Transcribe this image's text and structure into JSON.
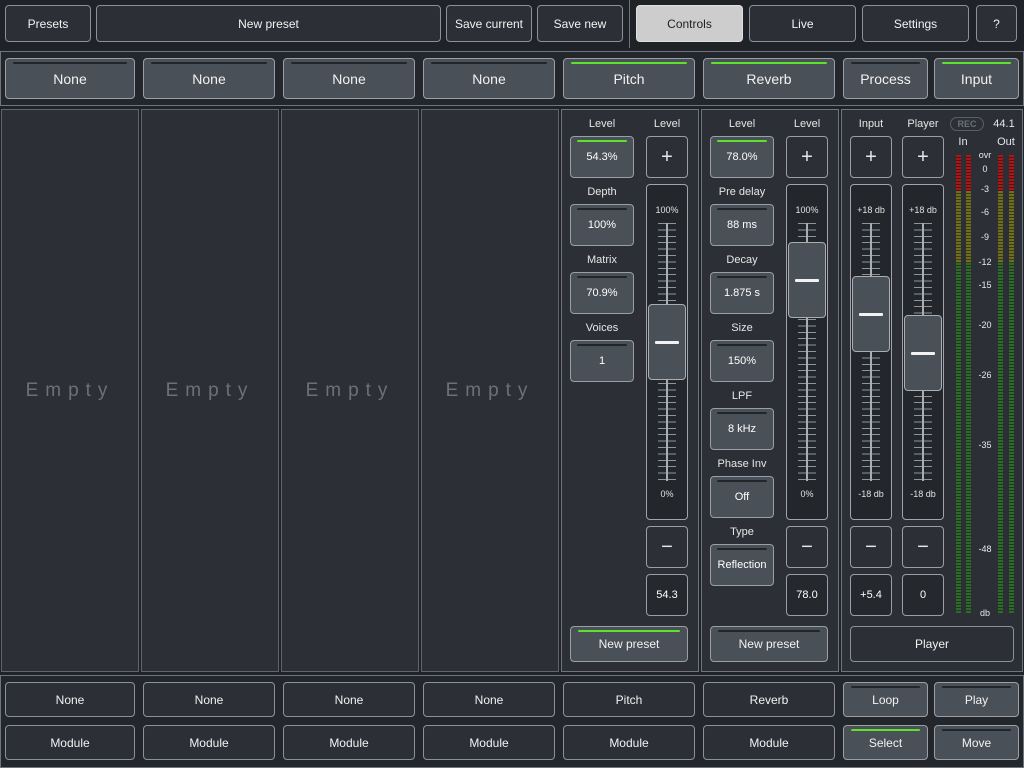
{
  "toolbar": {
    "presets": "Presets",
    "preset_name": "New preset",
    "save_current": "Save current",
    "save_new": "Save new",
    "controls": "Controls",
    "live": "Live",
    "settings": "Settings",
    "help": "?"
  },
  "slots": [
    {
      "label": "None",
      "active": false
    },
    {
      "label": "None",
      "active": false
    },
    {
      "label": "None",
      "active": false
    },
    {
      "label": "None",
      "active": false
    },
    {
      "label": "Pitch",
      "active": true
    },
    {
      "label": "Reverb",
      "active": true
    },
    {
      "label": "Process",
      "active": false
    },
    {
      "label": "Input",
      "active": true
    }
  ],
  "empty_label": "Empty",
  "pitch": {
    "level_label": "Level",
    "level_value": "54.3%",
    "depth_label": "Depth",
    "depth_value": "100%",
    "matrix_label": "Matrix",
    "matrix_value": "70.9%",
    "voices_label": "Voices",
    "voices_value": "1",
    "fader_label": "Level",
    "fader_top": "100%",
    "fader_bottom": "0%",
    "fader_value": "54.3",
    "fader_level": 0.543,
    "plus": "+",
    "minus": "−",
    "preset": "New preset"
  },
  "reverb": {
    "level_label": "Level",
    "level_value": "78.0%",
    "predelay_label": "Pre delay",
    "predelay_value": "88 ms",
    "decay_label": "Decay",
    "decay_value": "1.875 s",
    "size_label": "Size",
    "size_value": "150%",
    "lpf_label": "LPF",
    "lpf_value": "8 kHz",
    "phase_label": "Phase Inv",
    "phase_value": "Off",
    "type_label": "Type",
    "type_value": "Reflection",
    "fader_label": "Level",
    "fader_top": "100%",
    "fader_bottom": "0%",
    "fader_value": "78.0",
    "fader_level": 0.78,
    "plus": "+",
    "minus": "−",
    "preset": "New preset"
  },
  "input": {
    "input_label": "Input",
    "player_label": "Player",
    "rec": "REC",
    "rate": "44.1",
    "in_label": "In",
    "out_label": "Out",
    "fader_top": "+18 db",
    "fader_bottom": "-18 db",
    "input_value": "+5.4",
    "player_value": "0",
    "player_btn": "Player",
    "plus": "+",
    "minus": "−",
    "scale": [
      "ovr",
      "0",
      "-3",
      "-6",
      "-9",
      "-12",
      "-15",
      "-20",
      "-26",
      "-35",
      "-48",
      "db"
    ]
  },
  "bottom": {
    "row1": [
      "None",
      "None",
      "None",
      "None",
      "Pitch",
      "Reverb"
    ],
    "row2": [
      "Module",
      "Module",
      "Module",
      "Module",
      "Module",
      "Module"
    ],
    "loop": "Loop",
    "play": "Play",
    "select": "Select",
    "move": "Move"
  }
}
